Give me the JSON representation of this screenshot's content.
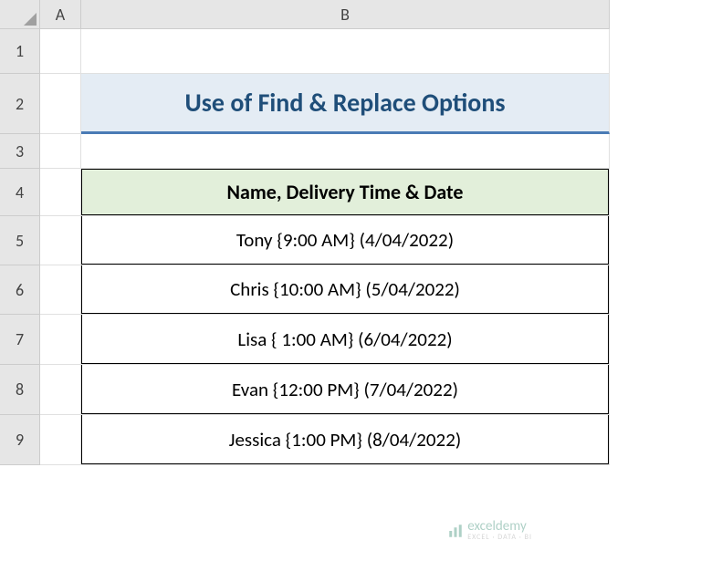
{
  "columns": {
    "A": "A",
    "B": "B"
  },
  "rows": {
    "1": "1",
    "2": "2",
    "3": "3",
    "4": "4",
    "5": "5",
    "6": "6",
    "7": "7",
    "8": "8",
    "9": "9"
  },
  "title": "Use of Find & Replace Options",
  "table": {
    "header": "Name, Delivery Time & Date",
    "rows": [
      "Tony {9:00 AM}  (4/04/2022)",
      "Chris {10:00 AM}  (5/04/2022)",
      "Lisa { 1:00 AM}  (6/04/2022)",
      "Evan {12:00 PM} (7/04/2022)",
      "Jessica {1:00 PM} (8/04/2022)"
    ]
  },
  "watermark": {
    "brand": "exceldemy",
    "tagline": "EXCEL · DATA · BI"
  }
}
